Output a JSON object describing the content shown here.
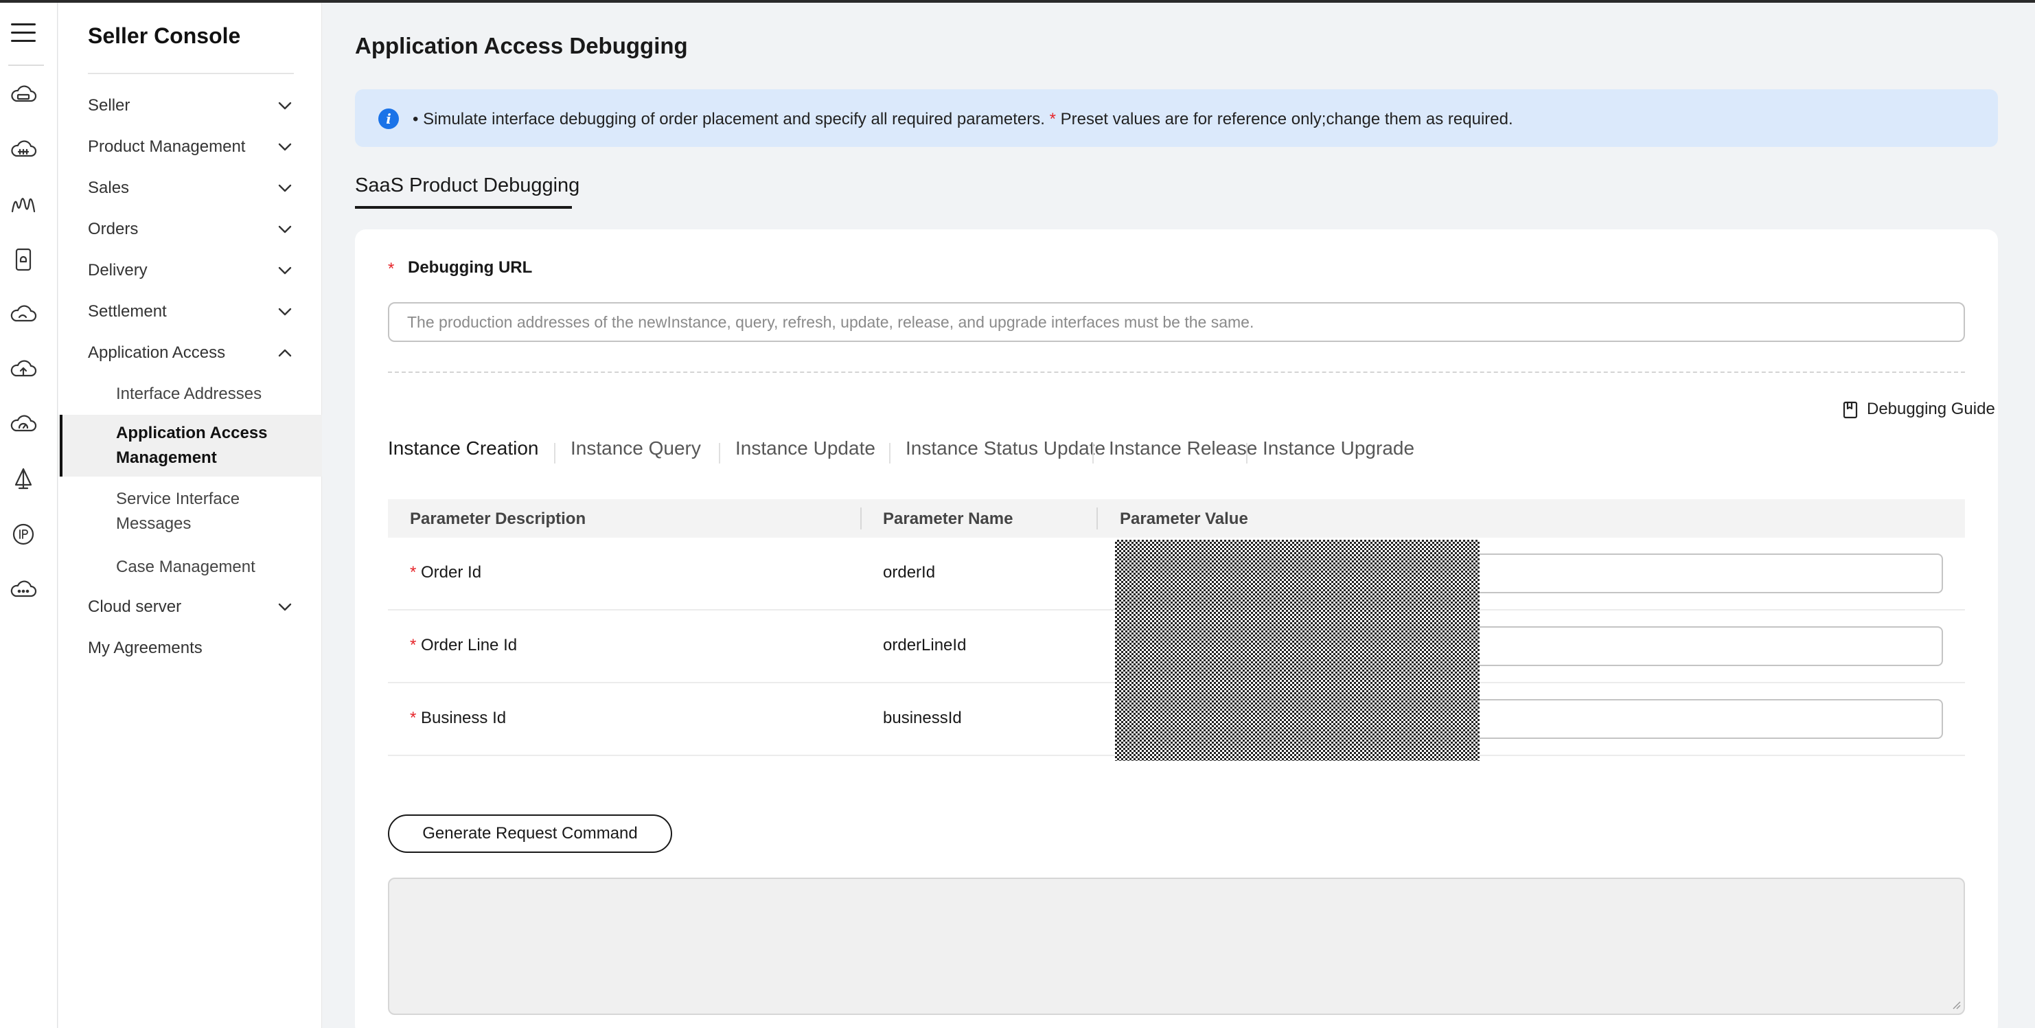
{
  "rail": {
    "icons": [
      "menu-icon",
      "cloud-storage-icon",
      "cloud-gpu-icon",
      "waveform-icon",
      "tablet-icon",
      "cloud-icon",
      "cloud-upload-icon",
      "cloud-speed-icon",
      "sail-icon",
      "ip-icon",
      "cloud-more-icon"
    ]
  },
  "sidebar": {
    "title": "Seller Console",
    "items": [
      {
        "label": "Seller",
        "expanded": false
      },
      {
        "label": "Product Management",
        "expanded": false
      },
      {
        "label": "Sales",
        "expanded": false
      },
      {
        "label": "Orders",
        "expanded": false
      },
      {
        "label": "Delivery",
        "expanded": false
      },
      {
        "label": "Settlement",
        "expanded": false
      },
      {
        "label": "Application Access",
        "expanded": true
      }
    ],
    "sub_items": [
      {
        "label": "Interface Addresses"
      },
      {
        "label": "Application Access Management",
        "active": true
      },
      {
        "label": "Service Interface Messages"
      },
      {
        "label": "Case Management"
      }
    ],
    "cloud_server": "Cloud server",
    "my_agreements": "My Agreements"
  },
  "main": {
    "title": "Application Access Debugging",
    "notice": {
      "part1": "• Simulate interface debugging of order placement and specify all required parameters.",
      "star": "*",
      "part2": "Preset values are for reference only;change them as required."
    },
    "tab": "SaaS Product Debugging",
    "url": {
      "required_mark": "*",
      "label": "Debugging URL",
      "value": "",
      "placeholder": "The production addresses of the newInstance, query, refresh, update, release, and upgrade interfaces must be the same."
    },
    "guide_label": "Debugging Guide",
    "subtabs": [
      "Instance Creation",
      "Instance Query",
      "Instance Update",
      "Instance Status Update",
      "Instance Release",
      "Instance Upgrade"
    ],
    "active_subtab": "Instance Creation",
    "table": {
      "headers": [
        "Parameter Description",
        "Parameter Name",
        "Parameter Value"
      ],
      "rows": [
        {
          "required": "*",
          "description": "Order Id",
          "name": "orderId",
          "value": ""
        },
        {
          "required": "*",
          "description": "Order Line Id",
          "name": "orderLineId",
          "value": ""
        },
        {
          "required": "*",
          "description": "Business Id",
          "name": "businessId",
          "value": ""
        }
      ]
    },
    "generate_button": "Generate Request Command",
    "output": ""
  }
}
